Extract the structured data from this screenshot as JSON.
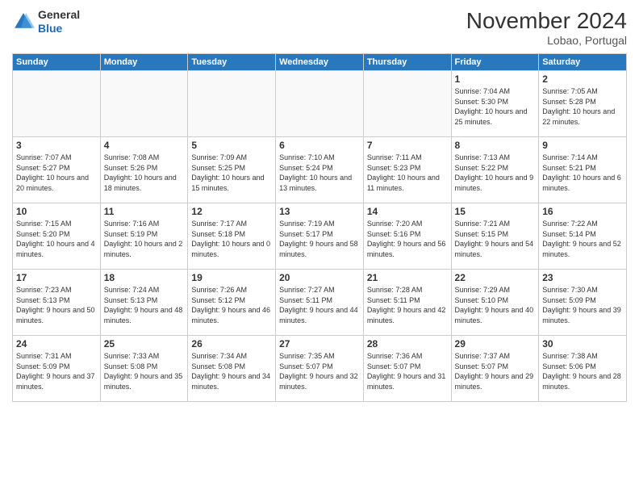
{
  "logo": {
    "general": "General",
    "blue": "Blue"
  },
  "header": {
    "month": "November 2024",
    "location": "Lobao, Portugal"
  },
  "weekdays": [
    "Sunday",
    "Monday",
    "Tuesday",
    "Wednesday",
    "Thursday",
    "Friday",
    "Saturday"
  ],
  "weeks": [
    [
      {
        "day": "",
        "info": ""
      },
      {
        "day": "",
        "info": ""
      },
      {
        "day": "",
        "info": ""
      },
      {
        "day": "",
        "info": ""
      },
      {
        "day": "",
        "info": ""
      },
      {
        "day": "1",
        "info": "Sunrise: 7:04 AM\nSunset: 5:30 PM\nDaylight: 10 hours and 25 minutes."
      },
      {
        "day": "2",
        "info": "Sunrise: 7:05 AM\nSunset: 5:28 PM\nDaylight: 10 hours and 22 minutes."
      }
    ],
    [
      {
        "day": "3",
        "info": "Sunrise: 7:07 AM\nSunset: 5:27 PM\nDaylight: 10 hours and 20 minutes."
      },
      {
        "day": "4",
        "info": "Sunrise: 7:08 AM\nSunset: 5:26 PM\nDaylight: 10 hours and 18 minutes."
      },
      {
        "day": "5",
        "info": "Sunrise: 7:09 AM\nSunset: 5:25 PM\nDaylight: 10 hours and 15 minutes."
      },
      {
        "day": "6",
        "info": "Sunrise: 7:10 AM\nSunset: 5:24 PM\nDaylight: 10 hours and 13 minutes."
      },
      {
        "day": "7",
        "info": "Sunrise: 7:11 AM\nSunset: 5:23 PM\nDaylight: 10 hours and 11 minutes."
      },
      {
        "day": "8",
        "info": "Sunrise: 7:13 AM\nSunset: 5:22 PM\nDaylight: 10 hours and 9 minutes."
      },
      {
        "day": "9",
        "info": "Sunrise: 7:14 AM\nSunset: 5:21 PM\nDaylight: 10 hours and 6 minutes."
      }
    ],
    [
      {
        "day": "10",
        "info": "Sunrise: 7:15 AM\nSunset: 5:20 PM\nDaylight: 10 hours and 4 minutes."
      },
      {
        "day": "11",
        "info": "Sunrise: 7:16 AM\nSunset: 5:19 PM\nDaylight: 10 hours and 2 minutes."
      },
      {
        "day": "12",
        "info": "Sunrise: 7:17 AM\nSunset: 5:18 PM\nDaylight: 10 hours and 0 minutes."
      },
      {
        "day": "13",
        "info": "Sunrise: 7:19 AM\nSunset: 5:17 PM\nDaylight: 9 hours and 58 minutes."
      },
      {
        "day": "14",
        "info": "Sunrise: 7:20 AM\nSunset: 5:16 PM\nDaylight: 9 hours and 56 minutes."
      },
      {
        "day": "15",
        "info": "Sunrise: 7:21 AM\nSunset: 5:15 PM\nDaylight: 9 hours and 54 minutes."
      },
      {
        "day": "16",
        "info": "Sunrise: 7:22 AM\nSunset: 5:14 PM\nDaylight: 9 hours and 52 minutes."
      }
    ],
    [
      {
        "day": "17",
        "info": "Sunrise: 7:23 AM\nSunset: 5:13 PM\nDaylight: 9 hours and 50 minutes."
      },
      {
        "day": "18",
        "info": "Sunrise: 7:24 AM\nSunset: 5:13 PM\nDaylight: 9 hours and 48 minutes."
      },
      {
        "day": "19",
        "info": "Sunrise: 7:26 AM\nSunset: 5:12 PM\nDaylight: 9 hours and 46 minutes."
      },
      {
        "day": "20",
        "info": "Sunrise: 7:27 AM\nSunset: 5:11 PM\nDaylight: 9 hours and 44 minutes."
      },
      {
        "day": "21",
        "info": "Sunrise: 7:28 AM\nSunset: 5:11 PM\nDaylight: 9 hours and 42 minutes."
      },
      {
        "day": "22",
        "info": "Sunrise: 7:29 AM\nSunset: 5:10 PM\nDaylight: 9 hours and 40 minutes."
      },
      {
        "day": "23",
        "info": "Sunrise: 7:30 AM\nSunset: 5:09 PM\nDaylight: 9 hours and 39 minutes."
      }
    ],
    [
      {
        "day": "24",
        "info": "Sunrise: 7:31 AM\nSunset: 5:09 PM\nDaylight: 9 hours and 37 minutes."
      },
      {
        "day": "25",
        "info": "Sunrise: 7:33 AM\nSunset: 5:08 PM\nDaylight: 9 hours and 35 minutes."
      },
      {
        "day": "26",
        "info": "Sunrise: 7:34 AM\nSunset: 5:08 PM\nDaylight: 9 hours and 34 minutes."
      },
      {
        "day": "27",
        "info": "Sunrise: 7:35 AM\nSunset: 5:07 PM\nDaylight: 9 hours and 32 minutes."
      },
      {
        "day": "28",
        "info": "Sunrise: 7:36 AM\nSunset: 5:07 PM\nDaylight: 9 hours and 31 minutes."
      },
      {
        "day": "29",
        "info": "Sunrise: 7:37 AM\nSunset: 5:07 PM\nDaylight: 9 hours and 29 minutes."
      },
      {
        "day": "30",
        "info": "Sunrise: 7:38 AM\nSunset: 5:06 PM\nDaylight: 9 hours and 28 minutes."
      }
    ]
  ]
}
